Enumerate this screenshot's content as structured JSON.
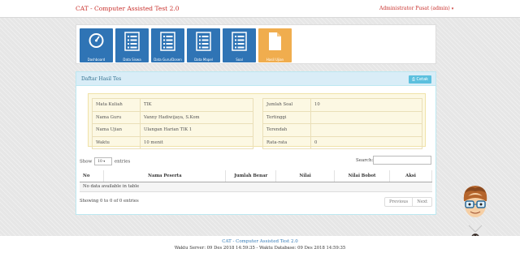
{
  "navbar": {
    "brand": "CAT - Computer Assisted Test 2.0",
    "user": "Administrator Pusat (admin)"
  },
  "menu": {
    "items": [
      {
        "label": "Dashboard",
        "icon": "dashboard-gauge-icon"
      },
      {
        "label": "Data Siswa",
        "icon": "list-icon"
      },
      {
        "label": "Data Guru/Dosen",
        "icon": "list-icon"
      },
      {
        "label": "Data Mapel",
        "icon": "list-icon"
      },
      {
        "label": "Soal",
        "icon": "list-icon"
      },
      {
        "label": "Hasil Ujian",
        "icon": "document-icon"
      }
    ],
    "active_index": 5
  },
  "panel": {
    "title": "Daftar Hasil Tes",
    "print_label": "Cetak",
    "print_icon": "print-icon"
  },
  "info": {
    "left": [
      {
        "key": "Mata Kuliah",
        "value": "TIK"
      },
      {
        "key": "Nama Guru",
        "value": "Vanny Hadiwijaya, S.Kom"
      },
      {
        "key": "Nama Ujian",
        "value": "Ulangan Harian TIK 1"
      },
      {
        "key": "Waktu",
        "value": "10 menit"
      }
    ],
    "right": [
      {
        "key": "Jumlah Soal",
        "value": "10"
      },
      {
        "key": "Tertinggi",
        "value": ""
      },
      {
        "key": "Terendah",
        "value": ""
      },
      {
        "key": "Rata-rata",
        "value": "0"
      }
    ]
  },
  "table_controls": {
    "show_label": "Show",
    "entries_value": "10",
    "entries_label": "entries",
    "search_label": "Search:"
  },
  "table": {
    "columns": [
      "No",
      "Nama Peserta",
      "Jumlah Benar",
      "Nilai",
      "Nilai Bobot",
      "Aksi"
    ],
    "empty_message": "No data available in table",
    "info": "Showing 0 to 0 of 0 entries",
    "previous": "Previous",
    "next": "Next"
  },
  "footer": {
    "line1": "CAT - Computer Assisted Test 2.0",
    "line2": "Waktu Server: 09 Des 2018 14:59:35 - Waktu Database: 09 Des 2018 14:59:35"
  },
  "colors": {
    "brand": "#c9302c",
    "tile": "#2f74b5",
    "tile_active": "#f0ad4e",
    "panel_head": "#d9edf7",
    "info_bg": "#fcf8e3",
    "print_button": "#5bc0de"
  }
}
